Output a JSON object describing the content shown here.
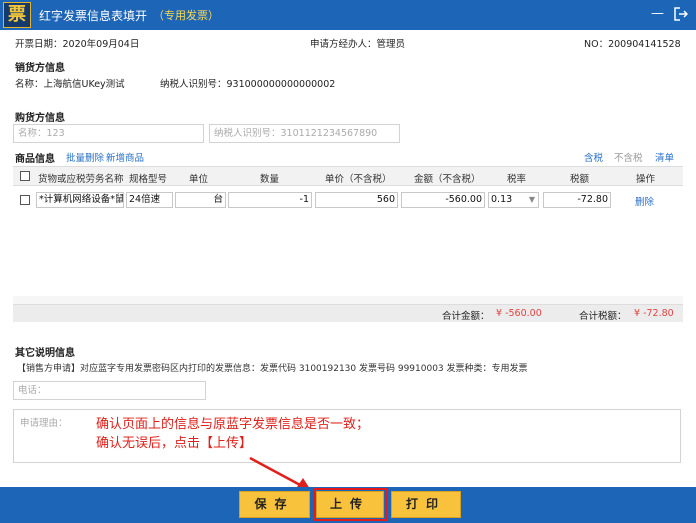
{
  "window": {
    "title": "红字发票信息表填开",
    "subtitle": "（专用发票）",
    "logo_char": "票"
  },
  "header": {
    "issue_date": "开票日期：2020年09月04日",
    "applicant": "申请方经办人：管理员",
    "number": "NO：200904141528"
  },
  "seller": {
    "section_title": "销货方信息",
    "name": "名称：上海航信UKey测试",
    "tax_id": "纳税人识别号：931000000000000002"
  },
  "buyer": {
    "section_title": "购货方信息",
    "name_label": "名称：",
    "name_value": "123",
    "tax_label": "纳税人识别号：",
    "tax_value": "3101121234567890"
  },
  "goods": {
    "section_title": "商品信息",
    "batch_delete": "批量删除",
    "add_item": "新增商品",
    "tax_included": "含税",
    "tax_excluded": "不含税",
    "clear": "清单",
    "columns": [
      "货物或应税劳务名称",
      "规格型号",
      "单位",
      "数量",
      "单价（不含税）",
      "金额（不含税）",
      "税率",
      "税额",
      "操作"
    ],
    "rows": [
      {
        "name": "*计算机网络设备*鼠",
        "spec": "24倍速",
        "unit": "台",
        "qty": "-1",
        "price": "560",
        "amount": "-560.00",
        "rate": "0.13",
        "tax": "-72.80",
        "action": "删除"
      }
    ],
    "total_amount_label": "合计金额：",
    "total_amount": "¥ -560.00",
    "total_tax_label": "合计税额：",
    "total_tax": "¥ -72.80"
  },
  "other": {
    "section_title": "其它说明信息",
    "note": "【销售方申请】对应蓝字专用发票密码区内打印的发票信息：发票代码 3100192130 发票号码 99910003 发票种类：专用发票",
    "phone_placeholder": "电话：",
    "reason_placeholder": "申请理由："
  },
  "annotation": {
    "line1": "确认页面上的信息与原蓝字发票信息是否一致；",
    "line2": "确认无误后，点击【上传】"
  },
  "footer": {
    "save": "保存",
    "upload": "上传",
    "print": "打印"
  },
  "colors": {
    "titlebar": "#1c65b7",
    "button": "#f9c23c",
    "highlight": "#e31b1b",
    "negative": "#e0443f"
  }
}
